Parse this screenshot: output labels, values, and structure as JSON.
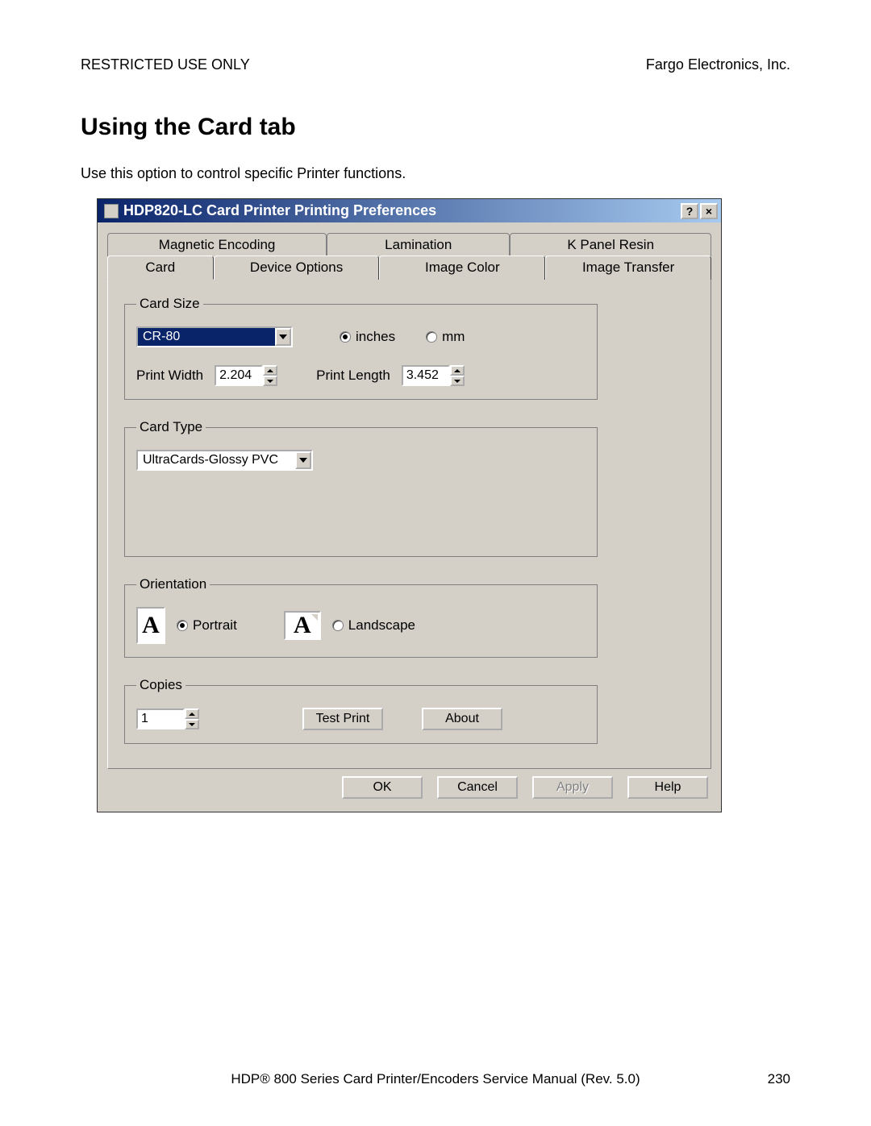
{
  "page": {
    "header_left": "RESTRICTED USE ONLY",
    "header_right": "Fargo Electronics, Inc.",
    "title": "Using the Card tab",
    "intro": "Use this option to control specific Printer functions.",
    "footer": "HDP® 800 Series Card Printer/Encoders Service Manual (Rev. 5.0)",
    "page_number": "230"
  },
  "dialog": {
    "title": "HDP820-LC Card Printer Printing Preferences",
    "help_btn": "?",
    "close_btn": "×",
    "tabs_back": [
      "Magnetic Encoding",
      "Lamination",
      "K Panel Resin"
    ],
    "tabs_front": [
      "Card",
      "Device Options",
      "Image Color",
      "Image Transfer"
    ],
    "card_size": {
      "legend": "Card Size",
      "size_value": "CR-80",
      "unit_inches": "inches",
      "unit_mm": "mm",
      "print_width_label": "Print Width",
      "print_width_value": "2.204",
      "print_length_label": "Print Length",
      "print_length_value": "3.452"
    },
    "card_type": {
      "legend": "Card Type",
      "value": "UltraCards-Glossy PVC"
    },
    "orientation": {
      "legend": "Orientation",
      "portrait": "Portrait",
      "landscape": "Landscape",
      "glyph": "A"
    },
    "copies": {
      "legend": "Copies",
      "value": "1",
      "test_print": "Test Print",
      "about": "About"
    },
    "buttons": {
      "ok": "OK",
      "cancel": "Cancel",
      "apply": "Apply",
      "help": "Help"
    }
  }
}
